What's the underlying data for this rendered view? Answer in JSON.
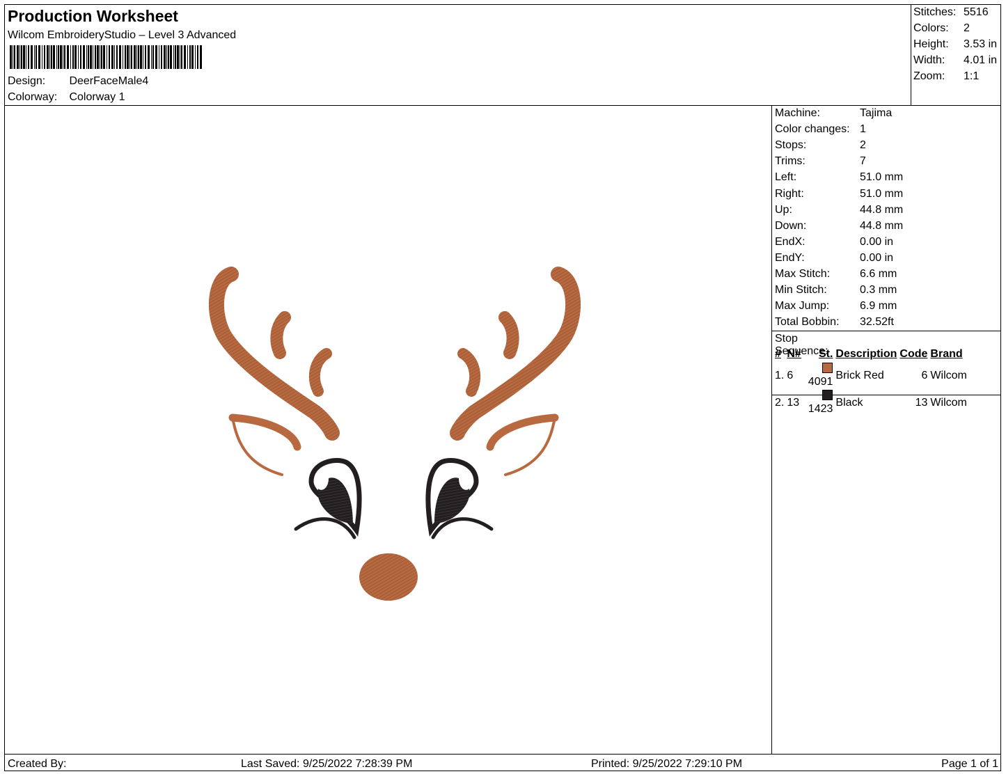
{
  "header": {
    "title": "Production Worksheet",
    "subtitle": "Wilcom EmbroideryStudio – Level 3 Advanced",
    "design_label": "Design:",
    "design_value": "DeerFaceMale4",
    "colorway_label": "Colorway:",
    "colorway_value": "Colorway 1"
  },
  "summary": {
    "stitches_label": "Stitches:",
    "stitches": "5516",
    "colors_label": "Colors:",
    "colors": "2",
    "height_label": "Height:",
    "height": "3.53 in",
    "width_label": "Width:",
    "width": "4.01 in",
    "zoom_label": "Zoom:",
    "zoom": "1:1"
  },
  "details": [
    {
      "label": "Machine:",
      "value": "Tajima"
    },
    {
      "label": "Color changes:",
      "value": "1"
    },
    {
      "label": "Stops:",
      "value": "2"
    },
    {
      "label": "Trims:",
      "value": "7"
    },
    {
      "label": "Left:",
      "value": "51.0 mm"
    },
    {
      "label": "Right:",
      "value": "51.0 mm"
    },
    {
      "label": "Up:",
      "value": "44.8 mm"
    },
    {
      "label": "Down:",
      "value": "44.8 mm"
    },
    {
      "label": "EndX:",
      "value": "0.00 in"
    },
    {
      "label": "EndY:",
      "value": "0.00 in"
    },
    {
      "label": "Max Stitch:",
      "value": "6.6 mm"
    },
    {
      "label": "Min Stitch:",
      "value": "0.3 mm"
    },
    {
      "label": "Max Jump:",
      "value": "6.9 mm"
    },
    {
      "label": "Total Bobbin:",
      "value": "32.52ft"
    }
  ],
  "stop_sequence": {
    "title": "Stop Sequence:",
    "columns": [
      "#",
      "N#",
      "St.",
      "Description",
      "Code",
      "Brand"
    ],
    "rows": [
      {
        "index": "1.",
        "needle": "6",
        "color": "#b8693f",
        "stitch": "4091",
        "description": "Brick Red",
        "code": "6",
        "brand": "Wilcom"
      },
      {
        "index": "2.",
        "needle": "13",
        "color": "#231f20",
        "stitch": "1423",
        "description": "Black",
        "code": "13",
        "brand": "Wilcom"
      }
    ]
  },
  "footer": {
    "created_by": "Created By:",
    "last_saved": "Last Saved: 9/25/2022 7:28:39 PM",
    "printed": "Printed: 9/25/2022 7:29:10 PM",
    "page": "Page 1 of 1"
  },
  "colors": {
    "brown": "#b8693f",
    "brown_dark": "#8a5030",
    "black": "#231f20"
  }
}
